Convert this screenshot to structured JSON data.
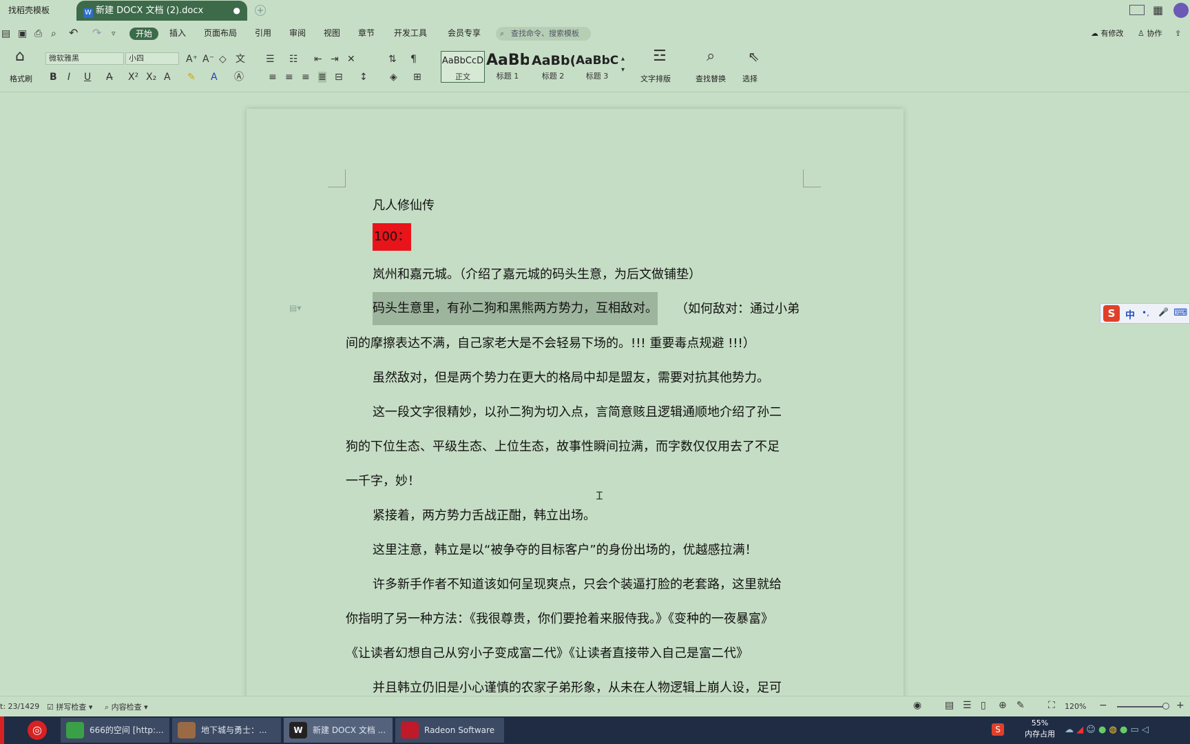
{
  "tabs": {
    "template_tab": "找稻壳模板",
    "document_tab": "新建 DOCX 文档 (2).docx",
    "doc_tab_badge": "W",
    "modified_dot": "●",
    "new_tab": "+"
  },
  "menu": {
    "items": [
      "开始",
      "插入",
      "页面布局",
      "引用",
      "审阅",
      "视图",
      "章节",
      "开发工具",
      "会员专享"
    ],
    "search_placeholder": "查找命令、搜索模板",
    "right": {
      "revise": "有修改",
      "collab": "协作"
    }
  },
  "ribbon": {
    "format_painter": "格式刷",
    "font_name": "微软雅黑",
    "font_size": "小四",
    "styles": [
      {
        "preview": "AaBbCcD",
        "label": "正文"
      },
      {
        "preview": "AaBb",
        "label": "标题 1"
      },
      {
        "preview": "AaBb(",
        "label": "标题 2"
      },
      {
        "preview": "AaBbC",
        "label": "标题 3"
      }
    ],
    "text_layout": "文字排版",
    "find_replace": "查找替换",
    "select": "选择",
    "bold": "B",
    "italic": "I",
    "underline": "U"
  },
  "document": {
    "paragraphs": [
      "凡人修仙传",
      "100：",
      "岚州和嘉元城。（介绍了嘉元城的码头生意，为后文做铺垫）",
      "码头生意里，有孙二狗和黑熊两方势力，互相敌对。",
      "（如何敌对：通过小弟",
      "间的摩擦表达不满，自己家老大是不会轻易下场的。!!! 重要毒点规避 !!!）",
      "虽然敌对，但是两个势力在更大的格局中却是盟友，需要对抗其他势力。",
      "这一段文字很精妙，以孙二狗为切入点，言简意赅且逻辑通顺地介绍了孙二",
      "狗的下位生态、平级生态、上位生态，故事性瞬间拉满，而字数仅仅用去了不足",
      "一千字，妙！",
      "紧接着，两方势力舌战正酣，韩立出场。",
      "这里注意，韩立是以“被争夺的目标客户”的身份出场的，优越感拉满！",
      "许多新手作者不知道该如何呈现爽点，只会个装逼打脸的老套路，这里就给",
      "你指明了另一种方法：《我很尊贵，你们要抢着来服侍我。》《变种的一夜暴富》",
      "《让读者幻想自己从穷小子变成富二代》《让读者直接带入自己是富二代》",
      "并且韩立仍旧是小心谨慎的农家子弟形象，从未在人物逻辑上崩人设，足可"
    ],
    "highlight_color": "#e8141a",
    "selection_color": "#9eb59d"
  },
  "ime": {
    "label": "中",
    "punct": "•,",
    "mic": "🎤",
    "kb": "⌨"
  },
  "status": {
    "page_count": "t: 23/1429",
    "spell_check": "拼写检查",
    "content_check": "内容检查",
    "zoom": "120%"
  },
  "taskbar": {
    "apps": [
      {
        "label": "666的空间 [http:...",
        "color": "#3aa048"
      },
      {
        "label": "地下城与勇士：...",
        "color": "#9a6a45"
      },
      {
        "label": "新建 DOCX 文档 ...",
        "color": "#222222"
      },
      {
        "label": "Radeon Software",
        "color": "#c0192a"
      }
    ],
    "memory_percent": "55%",
    "memory_label": "内存占用"
  }
}
